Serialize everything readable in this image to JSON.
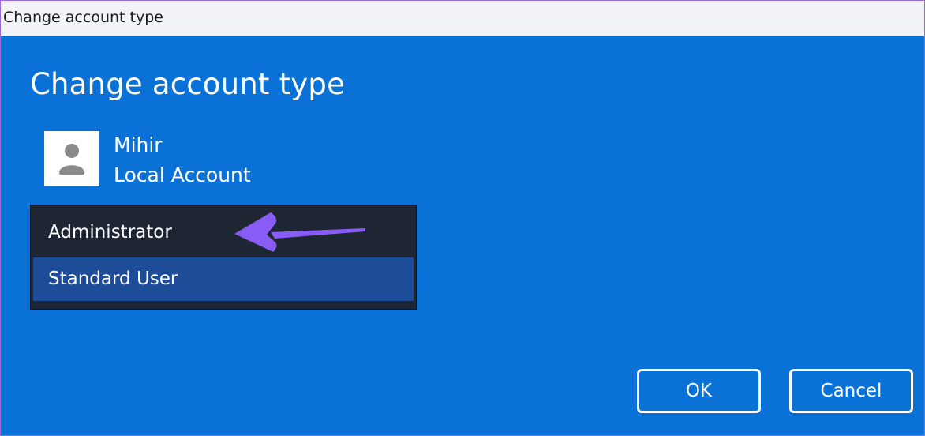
{
  "window": {
    "title": "Change account type"
  },
  "main": {
    "heading": "Change account type",
    "user": {
      "name": "Mihir",
      "account_type": "Local Account",
      "avatar_icon": "user-avatar-icon"
    },
    "account_type_options": [
      {
        "label": "Administrator",
        "highlighted": false
      },
      {
        "label": "Standard User",
        "highlighted": true
      }
    ],
    "annotation_arrow": {
      "icon": "arrow-left-icon",
      "color": "#8a5cf6"
    }
  },
  "buttons": {
    "ok_label": "OK",
    "cancel_label": "Cancel"
  },
  "colors": {
    "background": "#0a72d6",
    "titlebar": "#f2f3f7",
    "dropdown_bg": "#1f2633",
    "selected_option": "#1d4d99"
  }
}
